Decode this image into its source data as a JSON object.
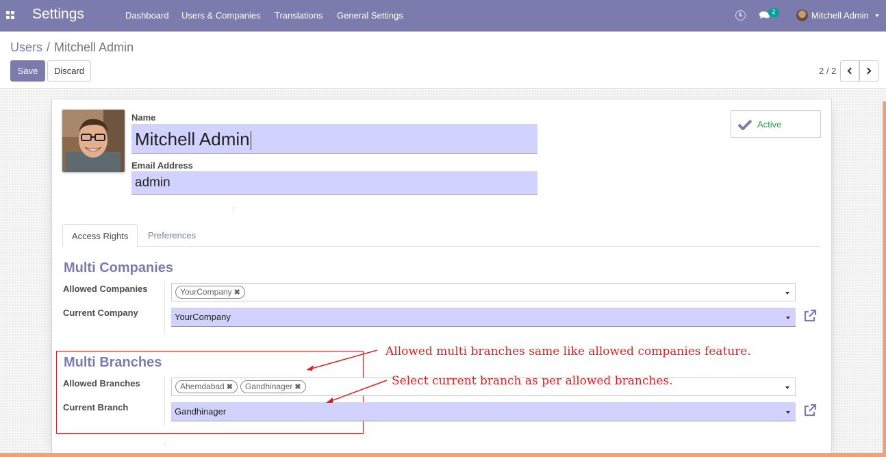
{
  "navbar": {
    "app_title": "Settings",
    "menu": [
      "Dashboard",
      "Users & Companies",
      "Translations",
      "General Settings"
    ],
    "chat_count": "2",
    "user_name": "Mitchell Admin",
    "icons": [
      "apps-grid-icon",
      "clock-icon",
      "chat-icon",
      "user-avatar",
      "caret-down-icon"
    ]
  },
  "control_panel": {
    "breadcrumb_parent": "Users",
    "breadcrumb_separator": "/",
    "breadcrumb_current": "Mitchell Admin",
    "save_label": "Save",
    "discard_label": "Discard",
    "pager": "2 / 2"
  },
  "form": {
    "name_label": "Name",
    "name_value": "Mitchell Admin",
    "email_label": "Email Address",
    "email_value": "admin",
    "active_label": "Active",
    "tabs": [
      "Access Rights",
      "Preferences"
    ],
    "multi_companies": {
      "title": "Multi Companies",
      "allowed_label": "Allowed Companies",
      "allowed_tags": [
        "YourCompany"
      ],
      "current_label": "Current Company",
      "current_value": "YourCompany"
    },
    "multi_branches": {
      "title": "Multi Branches",
      "allowed_label": "Allowed Branches",
      "allowed_tags": [
        "Ahemdabad",
        "Gandhinager"
      ],
      "current_label": "Current Branch",
      "current_value": "Gandhinager"
    }
  },
  "annotations": {
    "note_allowed": "Allowed multi branches same like allowed companies feature.",
    "note_current": "Select current branch as per allowed branches."
  },
  "colors": {
    "brand": "#7c7bad",
    "field_bg": "#d2d2ff",
    "active_green": "#28a745",
    "annotation_red": "#e02020",
    "accent_orange": "#f0a07a"
  }
}
